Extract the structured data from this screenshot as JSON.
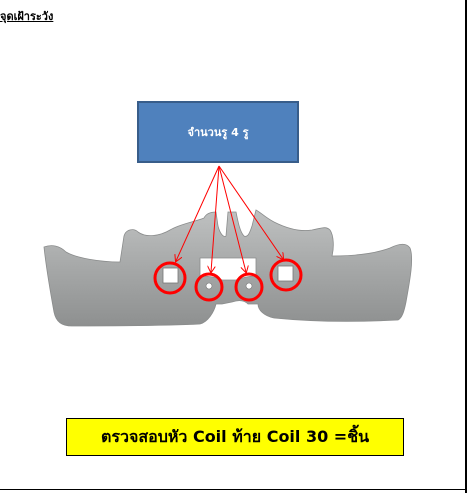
{
  "heading": "จุดเฝ้าระวัง",
  "callout": {
    "label": "จำนวนรู 4 รู",
    "fill_color": "#4f81bd",
    "border_color": "#385d8a"
  },
  "part_image": {
    "hole_marker_color": "#ff0000",
    "marked_holes": 4
  },
  "footer": {
    "text": "ตรวจสอบหัว Coil ท้าย Coil 30 =ชิ้น",
    "background_color": "#ffff00"
  }
}
